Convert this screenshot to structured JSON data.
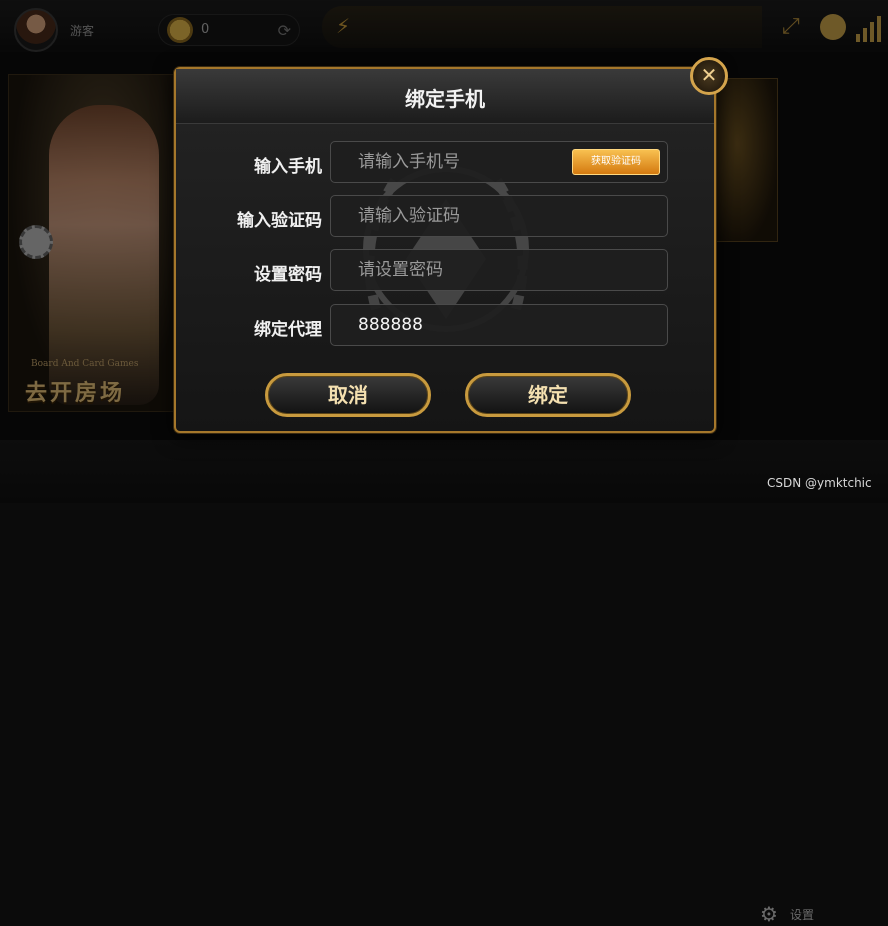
{
  "header": {
    "username": "游客",
    "coin_balance": "0"
  },
  "left_panel": {
    "subtitle": "Board And Card Games",
    "title": "去开房场"
  },
  "footer": {
    "settings_label": "设置",
    "watermark": "CSDN @ymktchic"
  },
  "dialog": {
    "title": "绑定手机",
    "close_symbol": "✕",
    "fields": [
      {
        "label": "输入手机",
        "value": "",
        "placeholder": "请输入手机号"
      },
      {
        "label": "输入验证码",
        "value": "",
        "placeholder": "请输入验证码"
      },
      {
        "label": "设置密码",
        "value": "",
        "placeholder": "请设置密码"
      },
      {
        "label": "绑定代理",
        "value": "888888",
        "placeholder": ""
      }
    ],
    "get_code_label": "获取验证码",
    "cancel_label": "取消",
    "confirm_label": "绑定"
  },
  "colors": {
    "accent_gold": "#c89a3e",
    "get_code_orange": "#e89a2a"
  },
  "icons": [
    "avatar",
    "coin-icon",
    "refresh-icon",
    "fullscreen-icon",
    "service-icon",
    "signal-icon",
    "close-icon",
    "settings-gear-icon"
  ]
}
